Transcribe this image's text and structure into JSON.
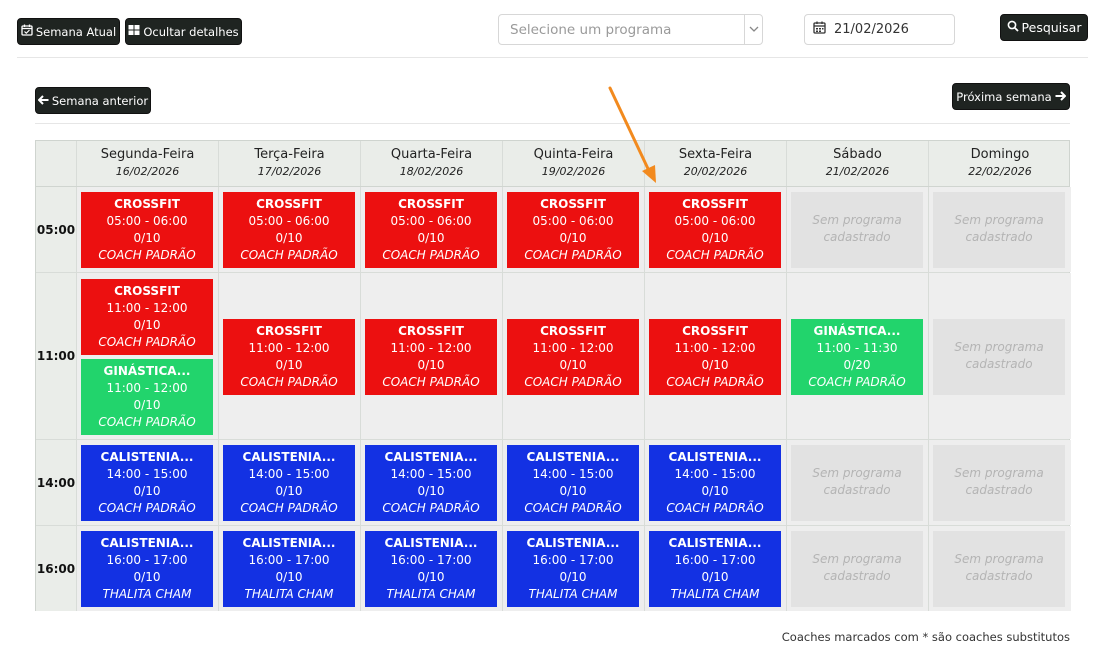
{
  "toolbar": {
    "current_week_label": "Semana Atual",
    "hide_details_label": "Ocultar detalhes",
    "program_placeholder": "Selecione um programa",
    "date_value": "21/02/2026",
    "search_label": "Pesquisar"
  },
  "nav": {
    "prev_week_label": "Semana anterior",
    "next_week_label": "Próxima semana"
  },
  "days": [
    {
      "name": "Segunda-Feira",
      "date": "16/02/2026"
    },
    {
      "name": "Terça-Feira",
      "date": "17/02/2026"
    },
    {
      "name": "Quarta-Feira",
      "date": "18/02/2026"
    },
    {
      "name": "Quinta-Feira",
      "date": "19/02/2026"
    },
    {
      "name": "Sexta-Feira",
      "date": "20/02/2026"
    },
    {
      "name": "Sábado",
      "date": "21/02/2026"
    },
    {
      "name": "Domingo",
      "date": "22/02/2026"
    }
  ],
  "empty_text": "Sem programa cadastrado",
  "rows": [
    {
      "time": "05:00",
      "cells": [
        [
          {
            "title": "CROSSFIT",
            "hours": "05:00 - 06:00",
            "count": "0/10",
            "coach": "COACH PADRÃO",
            "color": "#ec1010"
          }
        ],
        [
          {
            "title": "CROSSFIT",
            "hours": "05:00 - 06:00",
            "count": "0/10",
            "coach": "COACH PADRÃO",
            "color": "#ec1010"
          }
        ],
        [
          {
            "title": "CROSSFIT",
            "hours": "05:00 - 06:00",
            "count": "0/10",
            "coach": "COACH PADRÃO",
            "color": "#ec1010"
          }
        ],
        [
          {
            "title": "CROSSFIT",
            "hours": "05:00 - 06:00",
            "count": "0/10",
            "coach": "COACH PADRÃO",
            "color": "#ec1010"
          }
        ],
        [
          {
            "title": "CROSSFIT",
            "hours": "05:00 - 06:00",
            "count": "0/10",
            "coach": "COACH PADRÃO",
            "color": "#ec1010"
          }
        ],
        [],
        []
      ]
    },
    {
      "time": "11:00",
      "cells": [
        [
          {
            "title": "CROSSFIT",
            "hours": "11:00 - 12:00",
            "count": "0/10",
            "coach": "COACH PADRÃO",
            "color": "#ec1010"
          },
          {
            "title": "GINÁSTICA...",
            "hours": "11:00 - 12:00",
            "count": "0/10",
            "coach": "COACH PADRÃO",
            "color": "#22d46c"
          }
        ],
        [
          {
            "title": "CROSSFIT",
            "hours": "11:00 - 12:00",
            "count": "0/10",
            "coach": "COACH PADRÃO",
            "color": "#ec1010"
          }
        ],
        [
          {
            "title": "CROSSFIT",
            "hours": "11:00 - 12:00",
            "count": "0/10",
            "coach": "COACH PADRÃO",
            "color": "#ec1010"
          }
        ],
        [
          {
            "title": "CROSSFIT",
            "hours": "11:00 - 12:00",
            "count": "0/10",
            "coach": "COACH PADRÃO",
            "color": "#ec1010"
          }
        ],
        [
          {
            "title": "CROSSFIT",
            "hours": "11:00 - 12:00",
            "count": "0/10",
            "coach": "COACH PADRÃO",
            "color": "#ec1010"
          }
        ],
        [
          {
            "title": "GINÁSTICA...",
            "hours": "11:00 - 11:30",
            "count": "0/20",
            "coach": "COACH PADRÃO",
            "color": "#22d46c"
          }
        ],
        []
      ]
    },
    {
      "time": "14:00",
      "cells": [
        [
          {
            "title": "CALISTENIA...",
            "hours": "14:00 - 15:00",
            "count": "0/10",
            "coach": "COACH PADRÃO",
            "color": "#1331e3"
          }
        ],
        [
          {
            "title": "CALISTENIA...",
            "hours": "14:00 - 15:00",
            "count": "0/10",
            "coach": "COACH PADRÃO",
            "color": "#1331e3"
          }
        ],
        [
          {
            "title": "CALISTENIA...",
            "hours": "14:00 - 15:00",
            "count": "0/10",
            "coach": "COACH PADRÃO",
            "color": "#1331e3"
          }
        ],
        [
          {
            "title": "CALISTENIA...",
            "hours": "14:00 - 15:00",
            "count": "0/10",
            "coach": "COACH PADRÃO",
            "color": "#1331e3"
          }
        ],
        [
          {
            "title": "CALISTENIA...",
            "hours": "14:00 - 15:00",
            "count": "0/10",
            "coach": "COACH PADRÃO",
            "color": "#1331e3"
          }
        ],
        [],
        []
      ]
    },
    {
      "time": "16:00",
      "cells": [
        [
          {
            "title": "CALISTENIA...",
            "hours": "16:00 - 17:00",
            "count": "0/10",
            "coach": "THALITA CHAM",
            "color": "#1331e3"
          }
        ],
        [
          {
            "title": "CALISTENIA...",
            "hours": "16:00 - 17:00",
            "count": "0/10",
            "coach": "THALITA CHAM",
            "color": "#1331e3"
          }
        ],
        [
          {
            "title": "CALISTENIA...",
            "hours": "16:00 - 17:00",
            "count": "0/10",
            "coach": "THALITA CHAM",
            "color": "#1331e3"
          }
        ],
        [
          {
            "title": "CALISTENIA...",
            "hours": "16:00 - 17:00",
            "count": "0/10",
            "coach": "THALITA CHAM",
            "color": "#1331e3"
          }
        ],
        [
          {
            "title": "CALISTENIA...",
            "hours": "16:00 - 17:00",
            "count": "0/10",
            "coach": "THALITA CHAM",
            "color": "#1331e3"
          }
        ],
        [],
        []
      ]
    }
  ],
  "footnote": "Coaches marcados com * são coaches substitutos",
  "annotation": {
    "color": "#f28a1e"
  }
}
